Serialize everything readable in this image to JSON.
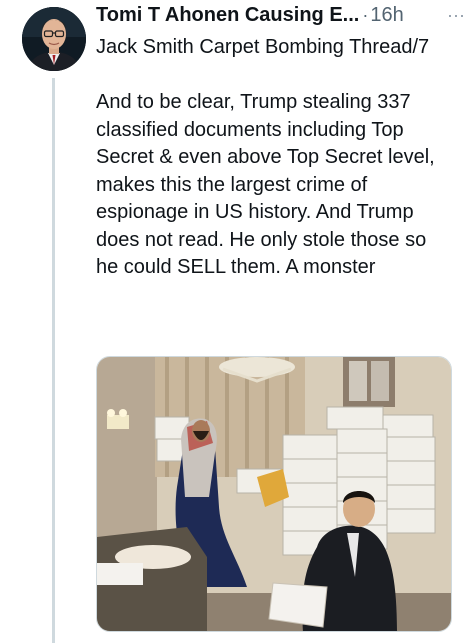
{
  "tweet": {
    "author_name": "Tomi T Ahonen Causing E...",
    "separator": "·",
    "timestamp": "16h",
    "more_glyph": "···",
    "subject": "Jack Smith Carpet Bombing Thread/7",
    "body": "And to be clear, Trump stealing 337 classified documents including Top Secret & even above Top Secret level, makes this the largest crime of espionage in US history. And Trump does not read. He only stole those so he could SELL them. A monster",
    "avatar_icon": "profile-photo",
    "media_icon": "photo-man-boxes-bathroom"
  },
  "colors": {
    "text": "#0f1419",
    "muted": "#536471",
    "thread_line": "#cfd9de"
  }
}
